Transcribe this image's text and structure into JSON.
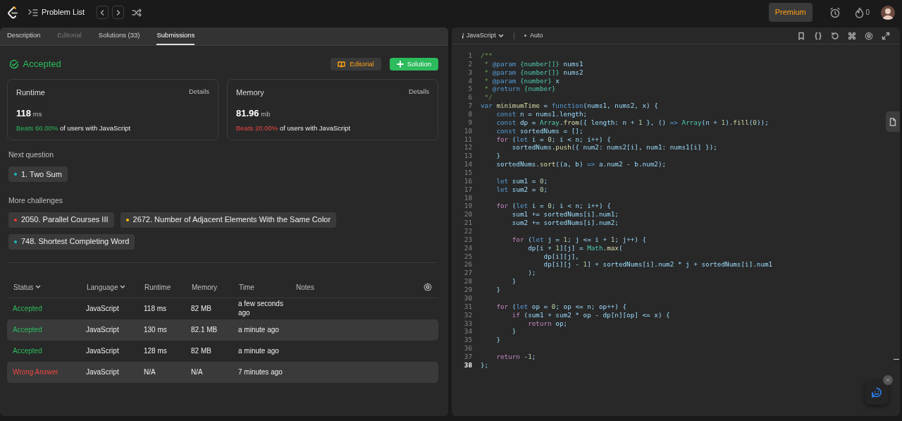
{
  "header": {
    "title": "Problem List",
    "premium": "Premium",
    "streak": "0"
  },
  "tabs": [
    {
      "label": "Description",
      "selected": false,
      "disabled": false
    },
    {
      "label": "Editorial",
      "selected": false,
      "disabled": true
    },
    {
      "label": "Solutions (33)",
      "selected": false,
      "disabled": false
    },
    {
      "label": "Submissions",
      "selected": true,
      "disabled": false
    }
  ],
  "result": {
    "status": "Accepted",
    "editorial_button": "Editorial",
    "solution_button": "Solution"
  },
  "stats": [
    {
      "title": "Runtime",
      "details": "Details",
      "value": "118",
      "unit": "ms",
      "beats": "Beats 60.00%",
      "positive": true,
      "rest": "of users with JavaScript"
    },
    {
      "title": "Memory",
      "details": "Details",
      "value": "81.96",
      "unit": "mb",
      "beats": "Beats 20.00%",
      "positive": false,
      "rest": "of users with JavaScript"
    }
  ],
  "next_question": {
    "heading": "Next question",
    "items": [
      {
        "label": "1. Two Sum",
        "color": "#1cb8b8"
      }
    ]
  },
  "more_challenges": {
    "heading": "More challenges",
    "items": [
      {
        "label": "2050. Parallel Courses III",
        "color": "#f63737"
      },
      {
        "label": "2672. Number of Adjacent Elements With the Same Color",
        "color": "#ffb800"
      },
      {
        "label": "748. Shortest Completing Word",
        "color": "#1cb8b8"
      }
    ]
  },
  "table": {
    "columns": [
      {
        "label": "Status",
        "sortable": true
      },
      {
        "label": "Language",
        "sortable": true
      },
      {
        "label": "Runtime",
        "sortable": false
      },
      {
        "label": "Memory",
        "sortable": false
      },
      {
        "label": "Time",
        "sortable": false
      },
      {
        "label": "Notes",
        "sortable": false
      }
    ],
    "rows": [
      {
        "status": "Accepted",
        "kind": "accepted",
        "language": "JavaScript",
        "runtime": "118 ms",
        "memory": "82 MB",
        "time": "a few seconds ago"
      },
      {
        "status": "Accepted",
        "kind": "accepted",
        "language": "JavaScript",
        "runtime": "130 ms",
        "memory": "82.1 MB",
        "time": "a minute ago"
      },
      {
        "status": "Accepted",
        "kind": "accepted",
        "language": "JavaScript",
        "runtime": "128 ms",
        "memory": "82 MB",
        "time": "a minute ago"
      },
      {
        "status": "Wrong Answer",
        "kind": "wrong",
        "language": "JavaScript",
        "runtime": "N/A",
        "memory": "N/A",
        "time": "7 minutes ago"
      }
    ]
  },
  "editor": {
    "language": "JavaScript",
    "mode": "Auto",
    "lines": [
      {
        "number": "1",
        "current": false,
        "segments": [
          {
            "kind": "comment",
            "text": "/**"
          }
        ]
      },
      {
        "number": "2",
        "current": false,
        "segments": [
          {
            "kind": "comment",
            "text": " * "
          },
          {
            "kind": "tag",
            "text": "@param"
          },
          {
            "kind": "type",
            "text": " {number[]}"
          },
          {
            "kind": "plain",
            "text": " nums1"
          }
        ]
      },
      {
        "number": "3",
        "current": false,
        "segments": [
          {
            "kind": "comment",
            "text": " * "
          },
          {
            "kind": "tag",
            "text": "@param"
          },
          {
            "kind": "type",
            "text": " {number[]}"
          },
          {
            "kind": "plain",
            "text": " nums2"
          }
        ]
      },
      {
        "number": "4",
        "current": false,
        "segments": [
          {
            "kind": "comment",
            "text": " * "
          },
          {
            "kind": "tag",
            "text": "@param"
          },
          {
            "kind": "type",
            "text": " {number}"
          },
          {
            "kind": "plain",
            "text": " x"
          }
        ]
      },
      {
        "number": "5",
        "current": false,
        "segments": [
          {
            "kind": "comment",
            "text": " * "
          },
          {
            "kind": "tag",
            "text": "@return"
          },
          {
            "kind": "type",
            "text": " {number}"
          }
        ]
      },
      {
        "number": "6",
        "current": false,
        "segments": [
          {
            "kind": "comment",
            "text": " */"
          }
        ]
      },
      {
        "number": "7",
        "current": false,
        "segments": [
          {
            "kind": "keyword",
            "text": "var "
          },
          {
            "kind": "function",
            "text": "minimumTime"
          },
          {
            "kind": "plain",
            "text": " = "
          },
          {
            "kind": "keyword",
            "text": "function"
          },
          {
            "kind": "plain",
            "text": "(nums1, nums2, x) {"
          }
        ]
      },
      {
        "number": "8",
        "current": false,
        "segments": [
          {
            "kind": "keyword",
            "text": "    const"
          },
          {
            "kind": "plain",
            "text": " n = nums1.length;"
          }
        ]
      },
      {
        "number": "9",
        "current": false,
        "segments": [
          {
            "kind": "keyword",
            "text": "    const"
          },
          {
            "kind": "plain",
            "text": " dp = "
          },
          {
            "kind": "class",
            "text": "Array"
          },
          {
            "kind": "plain",
            "text": "."
          },
          {
            "kind": "function",
            "text": "from"
          },
          {
            "kind": "plain",
            "text": "({ length: n + "
          },
          {
            "kind": "number",
            "text": "1"
          },
          {
            "kind": "plain",
            "text": " }, () "
          },
          {
            "kind": "keyword",
            "text": "=> "
          },
          {
            "kind": "class",
            "text": "Array"
          },
          {
            "kind": "plain",
            "text": "(n + "
          },
          {
            "kind": "number",
            "text": "1"
          },
          {
            "kind": "plain",
            "text": ")."
          },
          {
            "kind": "function",
            "text": "fill"
          },
          {
            "kind": "plain",
            "text": "("
          },
          {
            "kind": "number",
            "text": "0"
          },
          {
            "kind": "plain",
            "text": "));"
          }
        ]
      },
      {
        "number": "10",
        "current": false,
        "segments": [
          {
            "kind": "keyword",
            "text": "    const"
          },
          {
            "kind": "plain",
            "text": " sortedNums = [];"
          }
        ]
      },
      {
        "number": "11",
        "current": false,
        "segments": [
          {
            "kind": "control",
            "text": "    for"
          },
          {
            "kind": "plain",
            "text": " ("
          },
          {
            "kind": "keyword",
            "text": "let"
          },
          {
            "kind": "plain",
            "text": " i = "
          },
          {
            "kind": "number",
            "text": "0"
          },
          {
            "kind": "plain",
            "text": "; i < n; i++) {"
          }
        ]
      },
      {
        "number": "12",
        "current": false,
        "segments": [
          {
            "kind": "plain",
            "text": "        sortedNums."
          },
          {
            "kind": "function",
            "text": "push"
          },
          {
            "kind": "plain",
            "text": "({ num2: nums2[i], num1: nums1[i] });"
          }
        ]
      },
      {
        "number": "13",
        "current": false,
        "segments": [
          {
            "kind": "plain",
            "text": "    }"
          }
        ]
      },
      {
        "number": "14",
        "current": false,
        "segments": [
          {
            "kind": "plain",
            "text": "    sortedNums."
          },
          {
            "kind": "function",
            "text": "sort"
          },
          {
            "kind": "plain",
            "text": "((a, b) "
          },
          {
            "kind": "keyword",
            "text": "=>"
          },
          {
            "kind": "plain",
            "text": " a.num2 - b.num2);"
          }
        ]
      },
      {
        "number": "15",
        "current": false
      },
      {
        "number": "16",
        "current": false,
        "segments": [
          {
            "kind": "keyword",
            "text": "    let"
          },
          {
            "kind": "plain",
            "text": " sum1 = "
          },
          {
            "kind": "number",
            "text": "0"
          },
          {
            "kind": "plain",
            "text": ";"
          }
        ]
      },
      {
        "number": "17",
        "current": false,
        "segments": [
          {
            "kind": "keyword",
            "text": "    let"
          },
          {
            "kind": "plain",
            "text": " sum2 = "
          },
          {
            "kind": "number",
            "text": "0"
          },
          {
            "kind": "plain",
            "text": ";"
          }
        ]
      },
      {
        "number": "18",
        "current": false
      },
      {
        "number": "19",
        "current": false,
        "segments": [
          {
            "kind": "control",
            "text": "    for"
          },
          {
            "kind": "plain",
            "text": " ("
          },
          {
            "kind": "keyword",
            "text": "let"
          },
          {
            "kind": "plain",
            "text": " i = "
          },
          {
            "kind": "number",
            "text": "0"
          },
          {
            "kind": "plain",
            "text": "; i < n; i++) {"
          }
        ]
      },
      {
        "number": "20",
        "current": false,
        "segments": [
          {
            "kind": "plain",
            "text": "        sum1 += sortedNums[i].num1;"
          }
        ]
      },
      {
        "number": "21",
        "current": false,
        "segments": [
          {
            "kind": "plain",
            "text": "        sum2 += sortedNums[i].num2;"
          }
        ]
      },
      {
        "number": "22",
        "current": false
      },
      {
        "number": "23",
        "current": false,
        "segments": [
          {
            "kind": "control",
            "text": "        for"
          },
          {
            "kind": "plain",
            "text": " ("
          },
          {
            "kind": "keyword",
            "text": "let"
          },
          {
            "kind": "plain",
            "text": " j = "
          },
          {
            "kind": "number",
            "text": "1"
          },
          {
            "kind": "plain",
            "text": "; j <= i + "
          },
          {
            "kind": "number",
            "text": "1"
          },
          {
            "kind": "plain",
            "text": "; j++) {"
          }
        ]
      },
      {
        "number": "24",
        "current": false,
        "segments": [
          {
            "kind": "plain",
            "text": "            dp[i + "
          },
          {
            "kind": "number",
            "text": "1"
          },
          {
            "kind": "plain",
            "text": "][j] = "
          },
          {
            "kind": "class",
            "text": "Math"
          },
          {
            "kind": "plain",
            "text": "."
          },
          {
            "kind": "function",
            "text": "max"
          },
          {
            "kind": "plain",
            "text": "("
          }
        ]
      },
      {
        "number": "25",
        "current": false,
        "segments": [
          {
            "kind": "plain",
            "text": "                dp[i][j],"
          }
        ]
      },
      {
        "number": "26",
        "current": false,
        "segments": [
          {
            "kind": "plain",
            "text": "                dp[i][j - "
          },
          {
            "kind": "number",
            "text": "1"
          },
          {
            "kind": "plain",
            "text": "] + sortedNums[i].num2 * j + sortedNums[i].num1"
          }
        ]
      },
      {
        "number": "27",
        "current": false,
        "segments": [
          {
            "kind": "plain",
            "text": "            );"
          }
        ]
      },
      {
        "number": "28",
        "current": false,
        "segments": [
          {
            "kind": "plain",
            "text": "        }"
          }
        ]
      },
      {
        "number": "29",
        "current": false,
        "segments": [
          {
            "kind": "plain",
            "text": "    }"
          }
        ]
      },
      {
        "number": "30",
        "current": false
      },
      {
        "number": "31",
        "current": false,
        "segments": [
          {
            "kind": "control",
            "text": "    for"
          },
          {
            "kind": "plain",
            "text": " ("
          },
          {
            "kind": "keyword",
            "text": "let"
          },
          {
            "kind": "plain",
            "text": " op = "
          },
          {
            "kind": "number",
            "text": "0"
          },
          {
            "kind": "plain",
            "text": "; op <= n; op++) {"
          }
        ]
      },
      {
        "number": "32",
        "current": false,
        "segments": [
          {
            "kind": "control",
            "text": "        if"
          },
          {
            "kind": "plain",
            "text": " (sum1 + sum2 * op - dp[n][op] <= x) {"
          }
        ]
      },
      {
        "number": "33",
        "current": false,
        "segments": [
          {
            "kind": "control",
            "text": "            return"
          },
          {
            "kind": "plain",
            "text": " op;"
          }
        ]
      },
      {
        "number": "34",
        "current": false,
        "segments": [
          {
            "kind": "plain",
            "text": "        }"
          }
        ]
      },
      {
        "number": "35",
        "current": false,
        "segments": [
          {
            "kind": "plain",
            "text": "    }"
          }
        ]
      },
      {
        "number": "36",
        "current": false
      },
      {
        "number": "37",
        "current": false,
        "segments": [
          {
            "kind": "control",
            "text": "    return"
          },
          {
            "kind": "plain",
            "text": " -"
          },
          {
            "kind": "number",
            "text": "1"
          },
          {
            "kind": "plain",
            "text": ";"
          }
        ]
      },
      {
        "number": "38",
        "current": true,
        "segments": [
          {
            "kind": "plain",
            "text": "};"
          }
        ]
      }
    ]
  }
}
